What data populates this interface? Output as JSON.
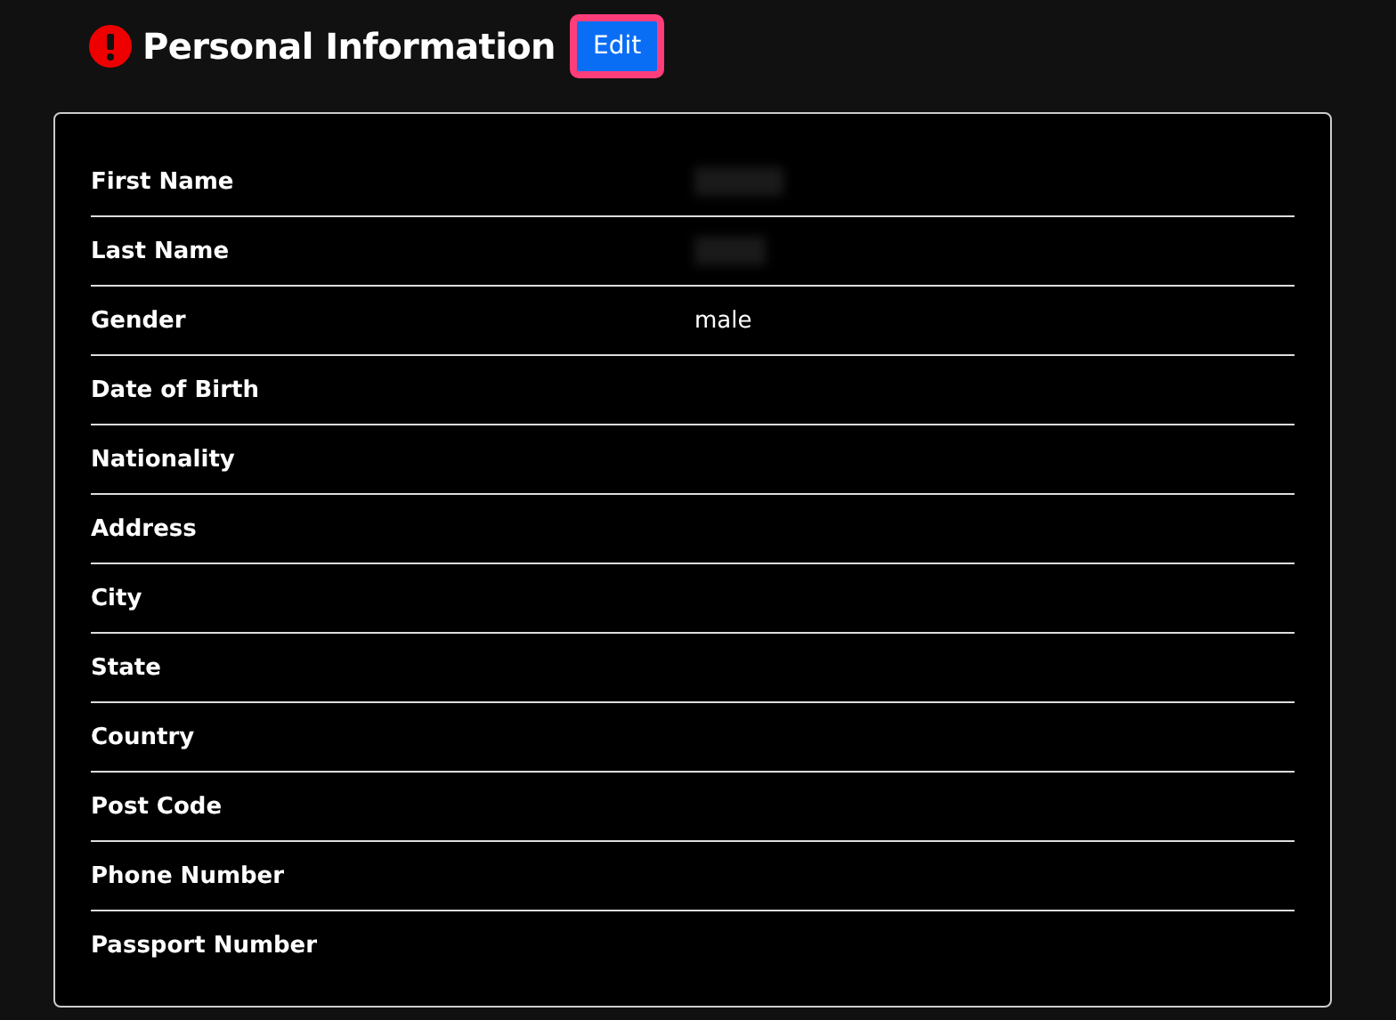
{
  "header": {
    "title": "Personal Information",
    "alert": true,
    "edit_button": "Edit"
  },
  "fields": [
    {
      "label": "First Name",
      "redacted": true
    },
    {
      "label": "Last Name",
      "redacted": true
    },
    {
      "label": "Gender",
      "value": "male"
    },
    {
      "label": "Date of Birth"
    },
    {
      "label": "Nationality"
    },
    {
      "label": "Address"
    },
    {
      "label": "City"
    },
    {
      "label": "State"
    },
    {
      "label": "Country"
    },
    {
      "label": "Post Code"
    },
    {
      "label": "Phone Number"
    },
    {
      "label": "Passport Number"
    }
  ]
}
